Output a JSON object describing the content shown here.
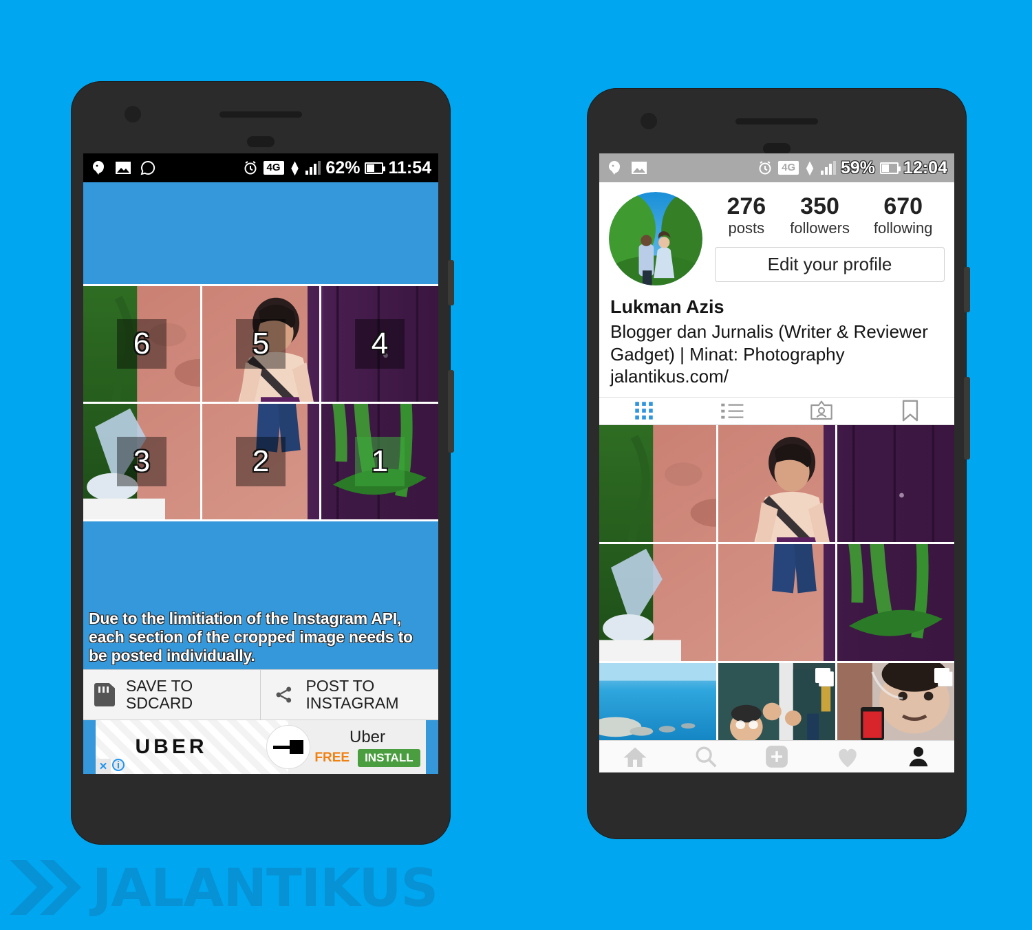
{
  "background_color": "#00A6F0",
  "phone_left": {
    "status_bar": {
      "icons": [
        "notification-icon",
        "photo-icon",
        "whatsapp-icon"
      ],
      "alarm_icon": "alarm-icon",
      "network": "4G",
      "battery_percent": "62%",
      "time": "11:54"
    },
    "app": {
      "background_color": "#3498DB",
      "grid": {
        "columns": 3,
        "rows": 2,
        "cells": [
          {
            "number": "6",
            "state": "pending"
          },
          {
            "number": "5",
            "state": "pending"
          },
          {
            "number": "4",
            "state": "pending"
          },
          {
            "number": "3",
            "state": "pending"
          },
          {
            "number": "2",
            "state": "pending"
          },
          {
            "number": "1",
            "state": "posted"
          }
        ]
      },
      "hint": "Due to the limitiation of the Instagram API, each section of the cropped image needs to be posted individually.",
      "actions": [
        {
          "icon": "sdcard-icon",
          "label_line1": "SAVE TO",
          "label_line2": "SDCARD"
        },
        {
          "icon": "share-icon",
          "label_line1": "POST TO",
          "label_line2": "INSTAGRAM"
        }
      ],
      "ad": {
        "brand_wordmark": "UBER",
        "title": "Uber",
        "price": "FREE",
        "install_label": "INSTALL",
        "close_icon": "close-icon",
        "info_icon": "info-icon"
      }
    }
  },
  "phone_right": {
    "status_bar": {
      "icons": [
        "notification-icon",
        "photo-icon"
      ],
      "alarm_icon": "alarm-icon",
      "network": "4G",
      "battery_percent": "59%",
      "time": "12:04"
    },
    "profile": {
      "avatar": "profile-photo",
      "stats": [
        {
          "value": "276",
          "label": "posts"
        },
        {
          "value": "350",
          "label": "followers"
        },
        {
          "value": "670",
          "label": "following"
        }
      ],
      "edit_button": "Edit your profile",
      "name": "Lukman Azis",
      "bio": "Blogger dan Jurnalis (Writer & Reviewer Gadget) | Minat: Photography",
      "website": "jalantikus.com/",
      "tabs": [
        {
          "icon": "grid-icon",
          "active": true
        },
        {
          "icon": "list-icon",
          "active": false
        },
        {
          "icon": "photos-of-you-icon",
          "active": false
        },
        {
          "icon": "bookmark-icon",
          "active": false
        }
      ],
      "active_tab_color": "#2f95e0",
      "bottom_nav": [
        {
          "icon": "home-icon",
          "active": false
        },
        {
          "icon": "search-icon",
          "active": false
        },
        {
          "icon": "add-post-icon",
          "active": false
        },
        {
          "icon": "heart-icon",
          "active": false
        },
        {
          "icon": "profile-icon",
          "active": true
        }
      ],
      "grid_posts": [
        {
          "position": "top-left",
          "multi": false
        },
        {
          "position": "top-center",
          "multi": false
        },
        {
          "position": "top-right",
          "multi": false
        },
        {
          "position": "middle-left",
          "multi": false
        },
        {
          "position": "middle-center",
          "multi": false
        },
        {
          "position": "middle-right",
          "multi": false
        },
        {
          "position": "bottom-left",
          "multi": false
        },
        {
          "position": "bottom-center",
          "multi": true
        },
        {
          "position": "bottom-right",
          "multi": true
        }
      ]
    }
  },
  "watermark": {
    "text": "JALANTIKUS",
    "logo": "chevron-logo",
    "color": "#0b86c4"
  }
}
